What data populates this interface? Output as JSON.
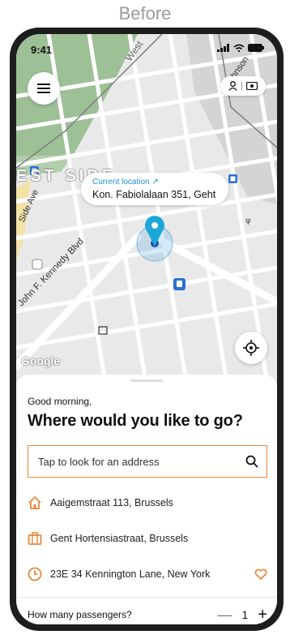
{
  "caption": "Before",
  "status_bar": {
    "time": "9:41"
  },
  "map": {
    "street_labels": [
      "West",
      "Johnson",
      "EST SIDE",
      "Side Ave",
      "John F. Kennedy Blvd"
    ],
    "current_location_label": "Current location ↗",
    "current_address": "Kon. Fabiolalaan 351, Geht",
    "attribution": "Google"
  },
  "sheet": {
    "greeting": "Good morning,",
    "title": "Where would you like to go?",
    "search_placeholder": "Tap to look for an address",
    "destinations": [
      {
        "icon": "home-icon",
        "label": "Aaigemstraat 113, Brussels"
      },
      {
        "icon": "briefcase-icon",
        "label": "Gent Hortensiastraat, Brussels"
      },
      {
        "icon": "clock-icon",
        "label": "23E 34 Kennington Lane, New York"
      }
    ],
    "passengers_label": "How many passengers?",
    "passenger_count": "1"
  },
  "colors": {
    "accent": "#e8883b",
    "pin": "#1a8fd6",
    "map_bg": "#e9e9ea",
    "park": "#8fb887"
  }
}
